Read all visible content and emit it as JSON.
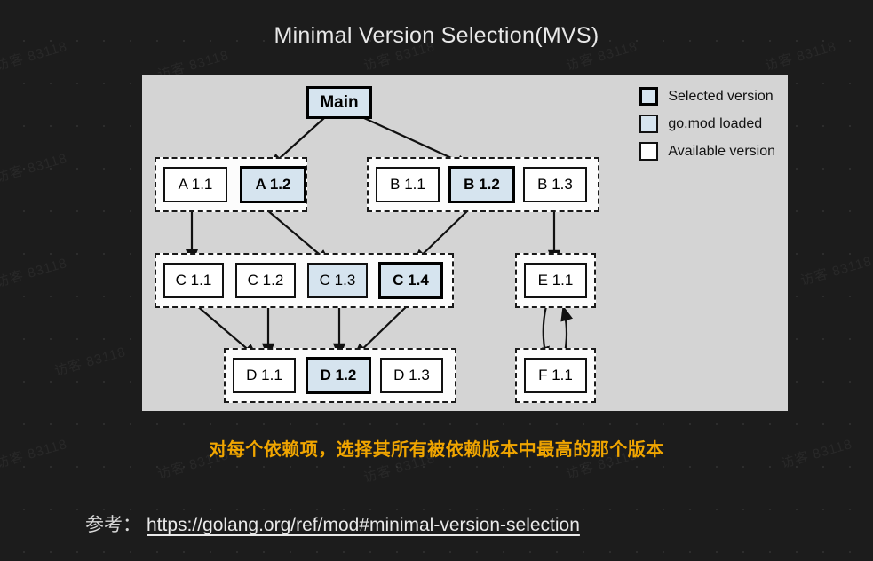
{
  "title": "Minimal Version Selection(MVS)",
  "colors": {
    "background": "#1c1c1c",
    "panel": "#d4d4d4",
    "group_fill": "#fcfcfc",
    "node_fill": "#ffffff",
    "loaded_fill": "#d6e4ef",
    "selected_border": "#000000",
    "caption": "#f0a500",
    "title": "#e8e8e8"
  },
  "legend": {
    "items": [
      {
        "label": "Selected version",
        "style": "selected"
      },
      {
        "label": "go.mod loaded",
        "style": "loaded"
      },
      {
        "label": "Available version",
        "style": "available"
      }
    ]
  },
  "diagram": {
    "root": {
      "label": "Main",
      "style": "root"
    },
    "groups": [
      {
        "name": "group-a",
        "nodes": [
          {
            "label": "A 1.1",
            "style": "available"
          },
          {
            "label": "A 1.2",
            "style": "selected"
          }
        ]
      },
      {
        "name": "group-b",
        "nodes": [
          {
            "label": "B 1.1",
            "style": "available"
          },
          {
            "label": "B 1.2",
            "style": "selected"
          },
          {
            "label": "B 1.3",
            "style": "available"
          }
        ]
      },
      {
        "name": "group-c",
        "nodes": [
          {
            "label": "C 1.1",
            "style": "available"
          },
          {
            "label": "C 1.2",
            "style": "available"
          },
          {
            "label": "C 1.3",
            "style": "loaded"
          },
          {
            "label": "C 1.4",
            "style": "selected"
          }
        ]
      },
      {
        "name": "group-e",
        "nodes": [
          {
            "label": "E 1.1",
            "style": "available"
          }
        ]
      },
      {
        "name": "group-d",
        "nodes": [
          {
            "label": "D 1.1",
            "style": "available"
          },
          {
            "label": "D 1.2",
            "style": "selected"
          },
          {
            "label": "D 1.3",
            "style": "available"
          }
        ]
      },
      {
        "name": "group-f",
        "nodes": [
          {
            "label": "F 1.1",
            "style": "available"
          }
        ]
      }
    ],
    "edges": [
      {
        "from": "Main",
        "to": "A 1.2"
      },
      {
        "from": "Main",
        "to": "B 1.2"
      },
      {
        "from": "A 1.1",
        "to": "C 1.1"
      },
      {
        "from": "A 1.2",
        "to": "C 1.3"
      },
      {
        "from": "B 1.2",
        "to": "C 1.4"
      },
      {
        "from": "B 1.3",
        "to": "E 1.1"
      },
      {
        "from": "C 1.1",
        "to": "D 1.1"
      },
      {
        "from": "C 1.2",
        "to": "D 1.1"
      },
      {
        "from": "C 1.3",
        "to": "D 1.2"
      },
      {
        "from": "C 1.4",
        "to": "D 1.2"
      },
      {
        "from": "E 1.1",
        "to": "F 1.1"
      },
      {
        "from": "F 1.1",
        "to": "E 1.1"
      }
    ]
  },
  "caption": "对每个依赖项，选择其所有被依赖版本中最高的那个版本",
  "footer": {
    "label": "参考：",
    "link": "https://golang.org/ref/mod#minimal-version-selection"
  },
  "watermark": {
    "text": "访客 83118"
  }
}
